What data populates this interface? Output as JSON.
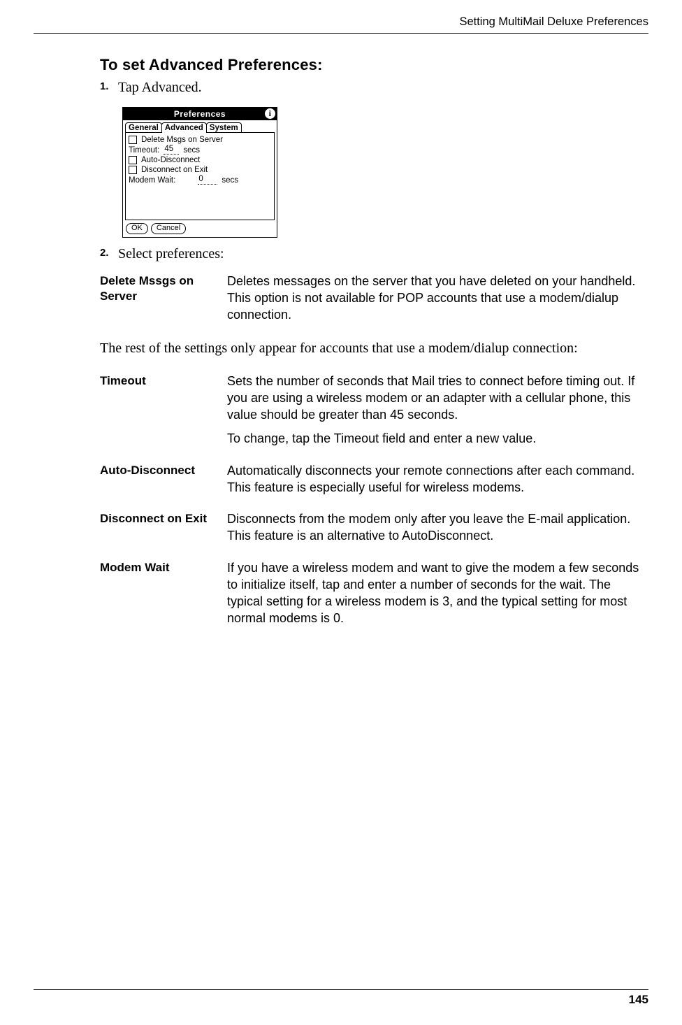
{
  "header": {
    "running_head": "Setting MultiMail Deluxe Preferences"
  },
  "heading": "To set Advanced Preferences:",
  "steps": [
    {
      "num": "1.",
      "text": "Tap Advanced."
    },
    {
      "num": "2.",
      "text": "Select preferences:"
    }
  ],
  "palm": {
    "title": "Preferences",
    "info_glyph": "i",
    "tabs": {
      "general": "General",
      "advanced": "Advanced",
      "system": "System"
    },
    "rows": {
      "delete": "Delete Msgs on Server",
      "timeout_label": "Timeout:",
      "timeout_value": "45",
      "secs": "secs",
      "autodisc": "Auto-Disconnect",
      "discexit": "Disconnect on Exit",
      "modemwait_label": "Modem Wait:",
      "modemwait_value": "0"
    },
    "buttons": {
      "ok": "OK",
      "cancel": "Cancel"
    }
  },
  "defs1": [
    {
      "term": "Delete Mssgs on Server",
      "desc": [
        "Deletes messages on the server that you have deleted on your handheld. This option is not available for POP accounts that use a modem/dialup connection."
      ]
    }
  ],
  "inter_paragraph": "The rest of the settings only appear for accounts that use a modem/dialup connection:",
  "defs2": [
    {
      "term": "Timeout",
      "desc": [
        "Sets the number of seconds that Mail tries to connect before timing out. If you are using a wireless modem or an adapter with a cellular phone, this value should be greater than 45 seconds.",
        "To change, tap the Timeout field and enter a new value."
      ]
    },
    {
      "term": "Auto-Disconnect",
      "desc": [
        "Automatically disconnects your remote connections after each command. This feature is especially useful for wireless modems."
      ]
    },
    {
      "term": "Disconnect on Exit",
      "desc": [
        "Disconnects from the modem only after you leave the E-mail application. This feature is an alternative to AutoDisconnect."
      ]
    },
    {
      "term": "Modem Wait",
      "desc": [
        "If you have a wireless modem and want to give the modem a few seconds to initialize itself, tap and enter a number of seconds for the wait. The typical setting for a wireless modem is 3, and the typical setting for most normal modems is 0."
      ]
    }
  ],
  "page_number": "145"
}
